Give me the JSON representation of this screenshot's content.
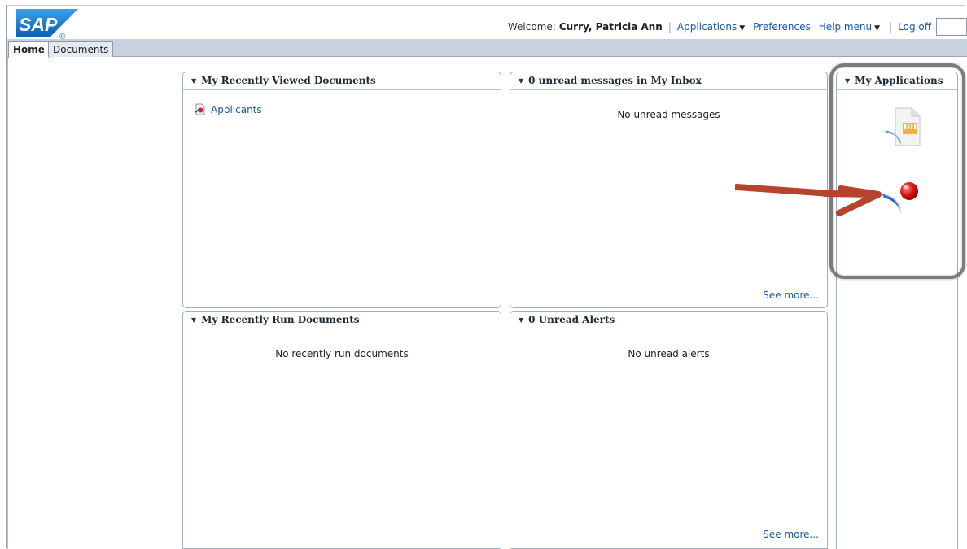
{
  "header": {
    "logo_text": "SAP",
    "welcome_label": "Welcome:",
    "user_name": "Curry, Patricia Ann",
    "links": [
      {
        "label": "Applications",
        "has_dropdown": true
      },
      {
        "label": "Preferences",
        "has_dropdown": false
      },
      {
        "label": "Help menu",
        "has_dropdown": true
      },
      {
        "label": "Log off",
        "has_dropdown": false
      }
    ],
    "search_value": ""
  },
  "tabs": [
    {
      "label": "Home",
      "active": true
    },
    {
      "label": "Documents",
      "active": false
    }
  ],
  "panels": {
    "recently_viewed": {
      "title": "My Recently Viewed Documents",
      "items": [
        {
          "label": "Applicants",
          "icon": "web-intelligence-document-icon"
        }
      ]
    },
    "inbox": {
      "title": "0 unread messages in My Inbox",
      "empty_message": "No unread messages",
      "see_more": "See more..."
    },
    "recently_run": {
      "title": "My Recently Run Documents",
      "empty_message": "No recently run documents"
    },
    "alerts": {
      "title": "0 Unread Alerts",
      "empty_message": "No unread alerts",
      "see_more": "See more..."
    },
    "my_applications": {
      "title": "My Applications",
      "apps": [
        {
          "icon": "crystal-reports-app-icon"
        },
        {
          "icon": "web-intelligence-app-icon"
        }
      ]
    }
  },
  "annotation": {
    "arrow_color": "#b5432d",
    "highlight_color": "#7c7c7c"
  },
  "colors": {
    "link": "#1a57a5",
    "tabstrip": "#c8d2de",
    "panel_border": "#9fb0c2",
    "logo_blue": "#1b74c9"
  }
}
